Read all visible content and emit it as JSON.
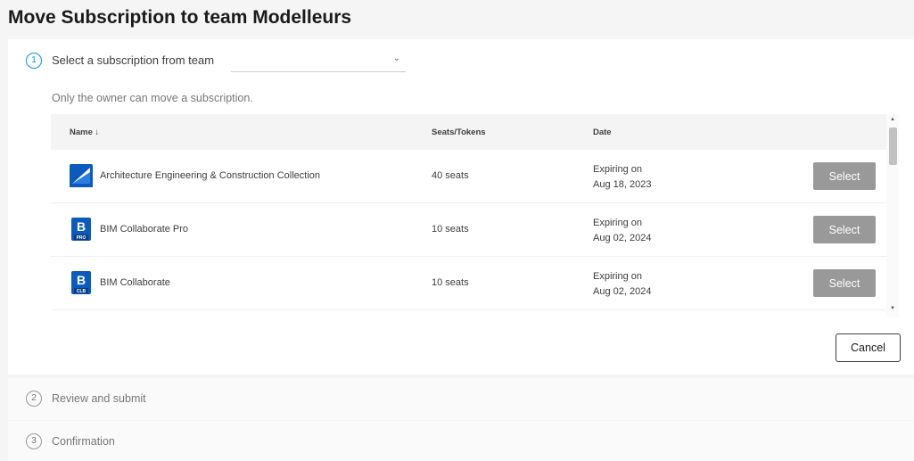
{
  "page": {
    "title": "Move Subscription to team Modelleurs"
  },
  "step1": {
    "number": "1",
    "label": "Select a subscription from team",
    "team_select_value": "",
    "owner_note": "Only the owner can move a subscription."
  },
  "table": {
    "headers": {
      "name": "Name ↓",
      "seats": "Seats/Tokens",
      "date": "Date"
    },
    "rows": [
      {
        "icon": "aec-collection-icon",
        "name": "Architecture Engineering & Construction Collection",
        "seats": "40 seats",
        "date_line1": "Expiring on",
        "date_line2": "Aug 18, 2023",
        "button": "Select"
      },
      {
        "icon": "bim-collaborate-pro-icon",
        "badge": "B",
        "sub": "PRO",
        "name": "BIM Collaborate Pro",
        "seats": "10 seats",
        "date_line1": "Expiring on",
        "date_line2": "Aug 02, 2024",
        "button": "Select"
      },
      {
        "icon": "bim-collaborate-icon",
        "badge": "B",
        "sub": "CLB",
        "name": "BIM Collaborate",
        "seats": "10 seats",
        "date_line1": "Expiring on",
        "date_line2": "Aug 02, 2024",
        "button": "Select"
      }
    ]
  },
  "actions": {
    "cancel": "Cancel"
  },
  "step2": {
    "number": "2",
    "label": "Review and submit"
  },
  "step3": {
    "number": "3",
    "label": "Confirmation"
  },
  "colors": {
    "accent": "#0696d7",
    "select_button": "#999999",
    "icon_blue": "#0a5bbd"
  }
}
